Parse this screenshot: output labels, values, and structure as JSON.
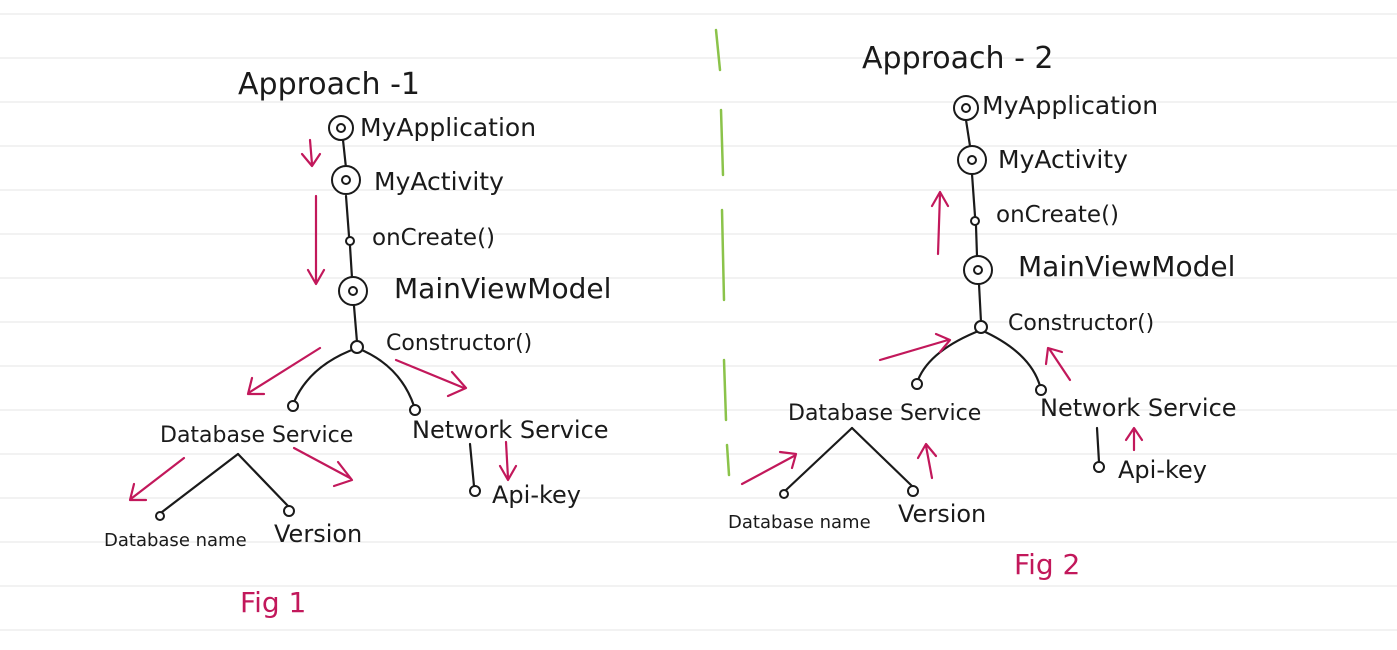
{
  "colors": {
    "ink": "#1a1a1a",
    "annotation": "#c2185b",
    "divider": "#8bc34a",
    "ruled_line": "#e4e4e4"
  },
  "fig1": {
    "title": "Approach -1",
    "nodes": {
      "app": "MyApplication",
      "activity": "MyActivity",
      "oncreate": "onCreate()",
      "viewmodel": "MainViewModel",
      "constructor": "Constructor()",
      "db_service": "Database Service",
      "net_service": "Network Service",
      "db_name": "Database name",
      "version": "Version",
      "api_key": "Api-key"
    },
    "caption": "Fig 1"
  },
  "fig2": {
    "title": "Approach - 2",
    "nodes": {
      "app": "MyApplication",
      "activity": "MyActivity",
      "oncreate": "onCreate()",
      "viewmodel": "MainViewModel",
      "constructor": "Constructor()",
      "db_service": "Database Service",
      "net_service": "Network Service",
      "db_name": "Database name",
      "version": "Version",
      "api_key": "Api-key"
    },
    "caption": "Fig 2"
  }
}
